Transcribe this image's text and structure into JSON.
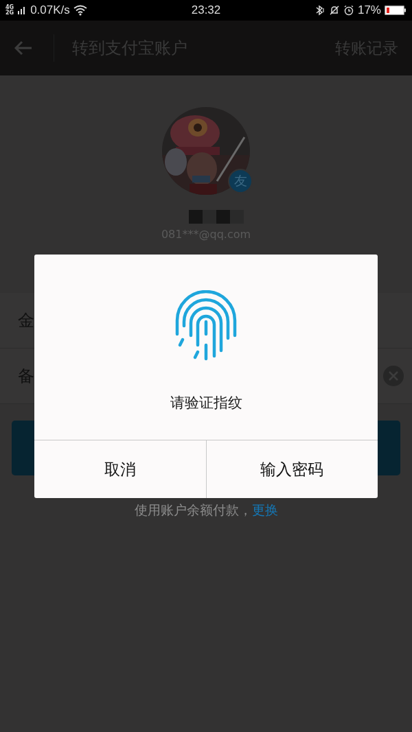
{
  "status_bar": {
    "network_types": [
      "4G",
      "2G"
    ],
    "speed": "0.07K/s",
    "time": "23:32",
    "battery": "17%"
  },
  "header": {
    "title": "转到支付宝账户",
    "action": "转账记录"
  },
  "recipient": {
    "badge": "友",
    "email": "081***@qq.com"
  },
  "form_rows": [
    {
      "label": "金",
      "clearable": false
    },
    {
      "label": "备",
      "clearable": true
    }
  ],
  "payment_note": {
    "text": "使用账户余额付款，",
    "link": "更换"
  },
  "dialog": {
    "message": "请验证指纹",
    "buttons": [
      "取消",
      "输入密码"
    ]
  }
}
